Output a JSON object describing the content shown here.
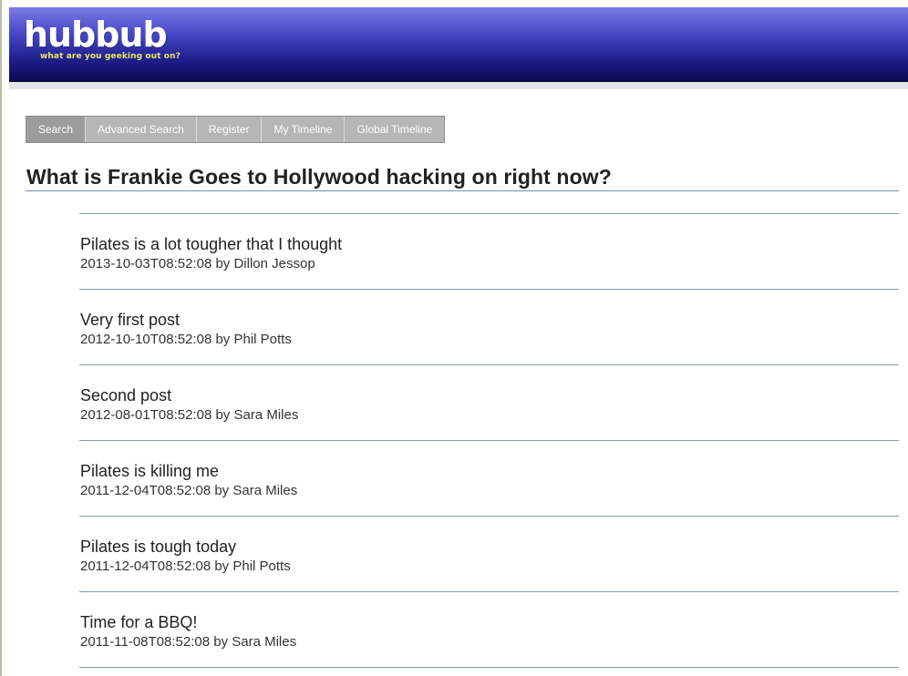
{
  "header": {
    "logo": "hubbub",
    "tagline": "what are you geeking out on?"
  },
  "nav": {
    "tabs": [
      {
        "label": "Search"
      },
      {
        "label": "Advanced Search"
      },
      {
        "label": "Register"
      },
      {
        "label": "My Timeline"
      },
      {
        "label": "Global Timeline"
      }
    ]
  },
  "main": {
    "title": "What is Frankie Goes to Hollywood hacking on right now?",
    "posts": [
      {
        "text": "Pilates is a lot tougher that I thought",
        "timestamp": "2013-10-03T08:52:08",
        "by": "by",
        "author": "Dillon Jessop"
      },
      {
        "text": "Very first post",
        "timestamp": "2012-10-10T08:52:08",
        "by": "by",
        "author": "Phil Potts"
      },
      {
        "text": "Second post",
        "timestamp": "2012-08-01T08:52:08",
        "by": "by",
        "author": "Sara Miles"
      },
      {
        "text": "Pilates is killing me",
        "timestamp": "2011-12-04T08:52:08",
        "by": "by",
        "author": "Sara Miles"
      },
      {
        "text": "Pilates is tough today",
        "timestamp": "2011-12-04T08:52:08",
        "by": "by",
        "author": "Phil Potts"
      },
      {
        "text": "Time for a BBQ!",
        "timestamp": "2011-11-08T08:52:08",
        "by": "by",
        "author": "Sara Miles"
      }
    ]
  },
  "colors": {
    "header_top": "#7b7be7",
    "header_bottom": "#0c0c56",
    "tagline": "#e8e860",
    "tab_bg": "#b6b6b6",
    "tab_active_bg": "#9c9c9c",
    "rule": "#8a98ac"
  }
}
